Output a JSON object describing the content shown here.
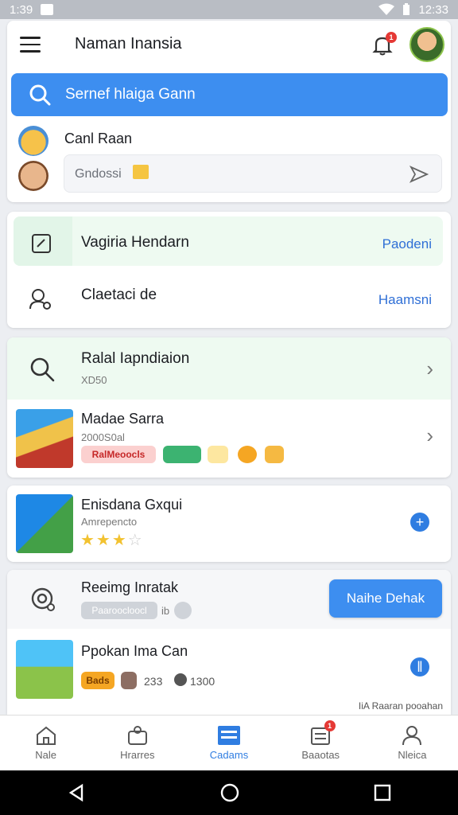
{
  "status": {
    "time_left": "1:39",
    "time_right": "12:33"
  },
  "header": {
    "title": "Naman Inansia",
    "notif_count": "1"
  },
  "search": {
    "placeholder": "Sernef hlaiga Gann"
  },
  "contact": {
    "name": "Canl Raan",
    "message_placeholder": "Gndossi"
  },
  "actions": [
    {
      "label": "Vagiria Hendarn",
      "link": "Paodeni"
    },
    {
      "label": "Claetaci de",
      "link": "Haamsni"
    }
  ],
  "search_result": {
    "title": "Ralal Iapndiaion",
    "sub": "XD50"
  },
  "items": [
    {
      "title": "Madae Sarra",
      "sub": "2000S0al",
      "tag": "RalMeoocls"
    },
    {
      "title": "Enisdana Gxqui",
      "sub": "Amrepencto",
      "rating": 3,
      "max_rating": 5
    },
    {
      "title": "Reeimg Inratak",
      "sub": "Paaroocloocl",
      "sub_suffix": "ib",
      "button": "Naihe Dehak"
    },
    {
      "title": "Ppokan Ima Can",
      "tag": "Bads",
      "count1": "233",
      "count2": "1300",
      "footer": "IiA Raaran pooahan"
    }
  ],
  "nav": [
    {
      "label": "Nale"
    },
    {
      "label": "Hrarres"
    },
    {
      "label": "Cadams"
    },
    {
      "label": "Baaotas",
      "badge": "1"
    },
    {
      "label": "Nleica"
    }
  ],
  "colors": {
    "accent": "#3d8ef0",
    "highlight": "#eefaf1",
    "star": "#f2c230",
    "badge": "#e53935"
  }
}
